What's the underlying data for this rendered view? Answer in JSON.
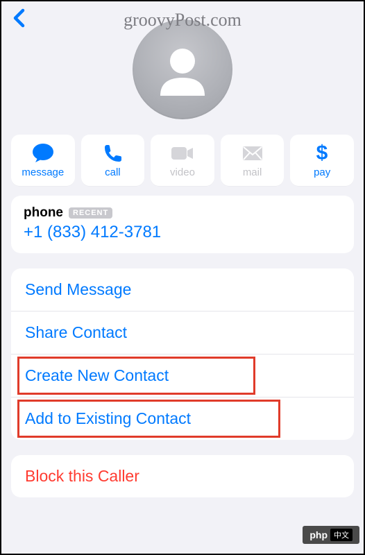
{
  "watermark": "groovyPost.com",
  "actions": {
    "message": "message",
    "call": "call",
    "video": "video",
    "mail": "mail",
    "pay": "pay"
  },
  "phone": {
    "label": "phone",
    "badge": "RECENT",
    "number": "+1 (833) 412-3781"
  },
  "options": {
    "send_message": "Send Message",
    "share_contact": "Share Contact",
    "create_new": "Create New Contact",
    "add_existing": "Add to Existing Contact"
  },
  "block": "Block this Caller",
  "badge": {
    "text": "php"
  }
}
